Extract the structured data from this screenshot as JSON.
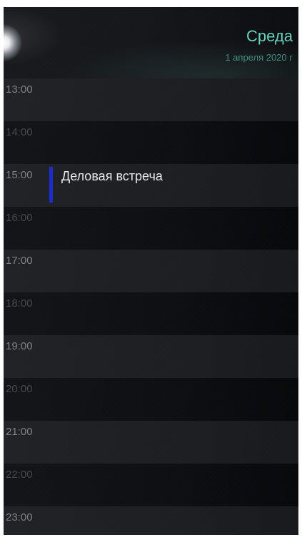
{
  "header": {
    "day_name": "Среда",
    "date": "1 апреля 2020 г"
  },
  "hours": [
    "13:00",
    "14:00",
    "15:00",
    "16:00",
    "17:00",
    "18:00",
    "19:00",
    "20:00",
    "21:00",
    "22:00",
    "23:00"
  ],
  "event": {
    "title": "Деловая встреча",
    "hour": "15:00",
    "color": "#1a2ad6"
  },
  "colors": {
    "accent": "#63d3bf",
    "date_text": "#3f8f81"
  }
}
